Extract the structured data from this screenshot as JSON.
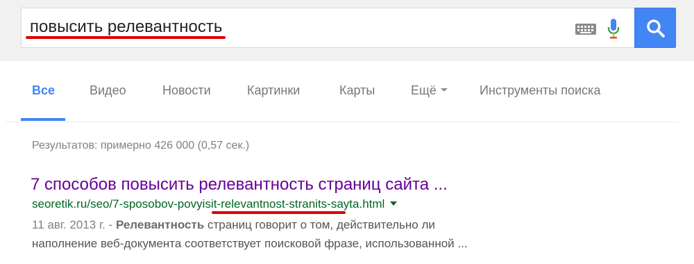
{
  "search": {
    "query": "повысить релевантность",
    "keyboard_icon": "keyboard-icon",
    "mic_icon": "microphone-icon",
    "button_icon": "search-icon",
    "accent_color": "#4285f4"
  },
  "tabs": [
    {
      "label": "Все",
      "active": true
    },
    {
      "label": "Видео",
      "active": false
    },
    {
      "label": "Новости",
      "active": false
    },
    {
      "label": "Картинки",
      "active": false
    },
    {
      "label": "Карты",
      "active": false
    },
    {
      "label": "Ещё",
      "active": false
    },
    {
      "label": "Инструменты поиска",
      "active": false
    }
  ],
  "results_stats": "Результатов: примерно 426 000 (0,57 сек.)",
  "results": [
    {
      "title": "7 способов повысить релевантность страниц сайта ...",
      "url": "seoretik.ru/seo/7-sposobov-povyisit-relevantnost-stranits-sayta.html",
      "date": "11 авг. 2013 г. - ",
      "snippet_bold": "Релевантность",
      "snippet_line1_rest": " страниц говорит о том, действительно ли",
      "snippet_line2": "наполнение веб-документа соответствует поисковой фразе, использованной ...",
      "title_color": "#660099",
      "url_color": "#006621"
    }
  ],
  "annotation_color": "#dd0000"
}
